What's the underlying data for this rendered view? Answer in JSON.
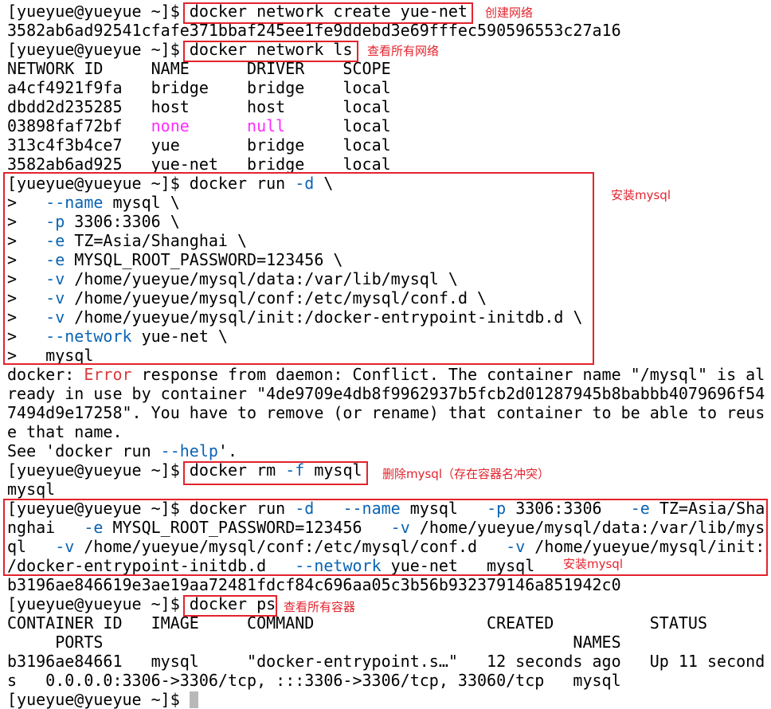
{
  "prompt": "[yueyue@yueyue ~]$ ",
  "cmd_create": "docker network create yue-net",
  "create_output": "3582ab6ad92541cfafe371bbaf245ee1fe9ddebd3e69fffec590596553c27a16",
  "cmd_ls": "docker network ls",
  "net_header": "NETWORK ID     NAME      DRIVER    SCOPE",
  "networks": [
    {
      "id": "a4cf4921f9fa",
      "name": "bridge",
      "driver": "bridge",
      "scope": "local"
    },
    {
      "id": "dbdd2d235285",
      "name": "host",
      "driver": "host",
      "scope": "local"
    },
    {
      "id": "03898faf72bf",
      "name": "none",
      "driver": "null",
      "scope": "local"
    },
    {
      "id": "313c4f3b4ce7",
      "name": "yue",
      "driver": "bridge",
      "scope": "local"
    },
    {
      "id": "3582ab6ad925",
      "name": "yue-net",
      "driver": "bridge",
      "scope": "local"
    }
  ],
  "run_lines": [
    {
      "pre": "[yueyue@yueyue ~]$ docker run ",
      "flag": "-d",
      "post": " \\"
    },
    {
      "pre": ">   ",
      "flag": "--name",
      "post": " mysql \\"
    },
    {
      "pre": ">   ",
      "flag": "-p",
      "post": " 3306:3306 \\"
    },
    {
      "pre": ">   ",
      "flag": "-e",
      "post": " TZ=Asia/Shanghai \\"
    },
    {
      "pre": ">   ",
      "flag": "-e",
      "post": " MYSQL_ROOT_PASSWORD=123456 \\"
    },
    {
      "pre": ">   ",
      "flag": "-v",
      "post": " /home/yueyue/mysql/data:/var/lib/mysql \\"
    },
    {
      "pre": ">   ",
      "flag": "-v",
      "post": " /home/yueyue/mysql/conf:/etc/mysql/conf.d \\"
    },
    {
      "pre": ">   ",
      "flag": "-v",
      "post": " /home/yueyue/mysql/init:/docker-entrypoint-initdb.d \\"
    },
    {
      "pre": ">   ",
      "flag": "--network",
      "post": " yue-net \\"
    },
    {
      "pre": ">   mysql",
      "flag": "",
      "post": ""
    }
  ],
  "error": {
    "line1_a": "docker: ",
    "line1_err": "Error",
    "line1_b": " response from daemon: Conflict. The container name \"/mysql\" is al",
    "line2": "ready in use by container \"4de9709e4db8f9962937b5fcb2d01287945b8babbb4079696f54",
    "line3": "7494d9e17258\". You have to remove (or rename) that container to be able to reus",
    "line4": "e that name.",
    "line5_a": "See 'docker run ",
    "line5_flag": "--help",
    "line5_b": "'."
  },
  "cmd_rm_a": "docker rm ",
  "cmd_rm_flag": "-f",
  "cmd_rm_b": " mysql",
  "rm_output": "mysql",
  "run2": {
    "l1": [
      {
        "t": "[yueyue@yueyue ~]$ docker run ",
        "k": false
      },
      {
        "t": "-d",
        "k": true
      },
      {
        "t": "   ",
        "k": false
      },
      {
        "t": "--name",
        "k": true
      },
      {
        "t": " mysql   ",
        "k": false
      },
      {
        "t": "-p",
        "k": true
      },
      {
        "t": " 3306:3306   ",
        "k": false
      },
      {
        "t": "-e",
        "k": true
      },
      {
        "t": " TZ=Asia/Sha",
        "k": false
      }
    ],
    "l2": [
      {
        "t": "nghai   ",
        "k": false
      },
      {
        "t": "-e",
        "k": true
      },
      {
        "t": " MYSQL_ROOT_PASSWORD=123456   ",
        "k": false
      },
      {
        "t": "-v",
        "k": true
      },
      {
        "t": " /home/yueyue/mysql/data:/var/lib/mys",
        "k": false
      }
    ],
    "l3": [
      {
        "t": "ql   ",
        "k": false
      },
      {
        "t": "-v",
        "k": true
      },
      {
        "t": " /home/yueyue/mysql/conf:/etc/mysql/conf.d   ",
        "k": false
      },
      {
        "t": "-v",
        "k": true
      },
      {
        "t": " /home/yueyue/mysql/init:",
        "k": false
      }
    ],
    "l4": [
      {
        "t": "/docker-entrypoint-initdb.d   ",
        "k": false
      },
      {
        "t": "--network",
        "k": true
      },
      {
        "t": " yue-net   mysql",
        "k": false
      }
    ]
  },
  "run2_output": "b3196ae846619e3ae19aa72481fdcf84c696aa05c3b56b932379146a851942c0",
  "cmd_ps": "docker ps",
  "ps_header1": "CONTAINER ID   IMAGE     COMMAND                  CREATED          STATUS",
  "ps_header2": "     PORTS                                                 NAMES",
  "ps_row1": "b3196ae84661   mysql     \"docker-entrypoint.s…\"   12 seconds ago   Up 11 second",
  "ps_row2": "s   0.0.0.0:3306->3306/tcp, :::3306->3306/tcp, 33060/tcp   mysql",
  "final_prompt": "[yueyue@yueyue ~]$ ",
  "notes": {
    "create": "创建网络",
    "ls": "查看所有网络",
    "install1": "安装mysql",
    "rm": "删除mysql（存在容器名冲突）",
    "install2": "安装mysql",
    "ps": "查看所有容器"
  },
  "colors": {
    "flag": "#0a64b4",
    "error": "#d83b3b",
    "none": "#ff2bff",
    "annotation": "#e3232d"
  }
}
